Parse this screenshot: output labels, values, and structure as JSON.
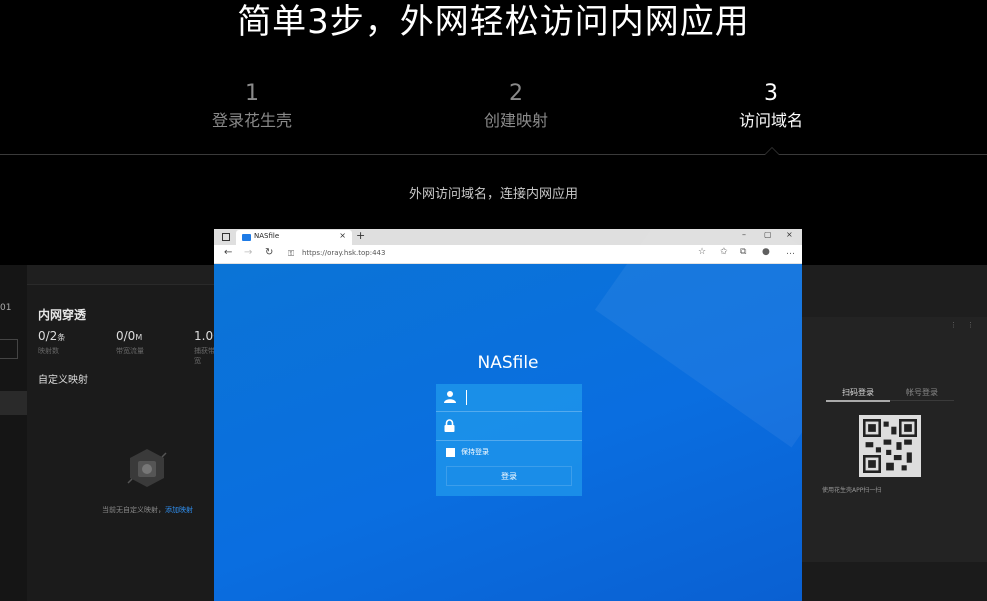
{
  "headline": "简单3步，外网轻松访问内网应用",
  "steps": [
    {
      "num": "1",
      "label": "登录花生壳"
    },
    {
      "num": "2",
      "label": "创建映射"
    },
    {
      "num": "3",
      "label": "访问域名"
    }
  ],
  "active_step": "3",
  "subtitle": "外网访问域名，连接内网应用",
  "background_app": {
    "rail_text": "01",
    "panel_title": "内网穿透",
    "stats": [
      {
        "value": "0/2",
        "unit": "条",
        "label": "映射数"
      },
      {
        "value": "0/0",
        "unit": "M",
        "label": "带宽流量"
      },
      {
        "value": "1.00",
        "unit": "",
        "label": "捕获带宽"
      }
    ],
    "custom_map": "自定义映射",
    "empty_text": "当前无自定义映射，",
    "empty_link": "添加映射",
    "qr_tabs": [
      "扫码登录",
      "帐号登录"
    ],
    "qr_caption": "使用花生壳APP扫一扫"
  },
  "browser": {
    "tab_title": "NASfile",
    "tab_close": "×",
    "new_tab": "+",
    "window_controls": [
      "–",
      "▢",
      "×"
    ],
    "nav": [
      "←",
      "→",
      "↻"
    ],
    "lock": "⚿",
    "url": "https://oray.hsk.top:443",
    "toolbar_icons": [
      "☆",
      "✩",
      "⧉",
      "●",
      "…"
    ],
    "app_title": "NASfile",
    "user_icon": "👤",
    "password_icon": "🔒",
    "remember_label": "保持登录",
    "login_label": "登录"
  }
}
